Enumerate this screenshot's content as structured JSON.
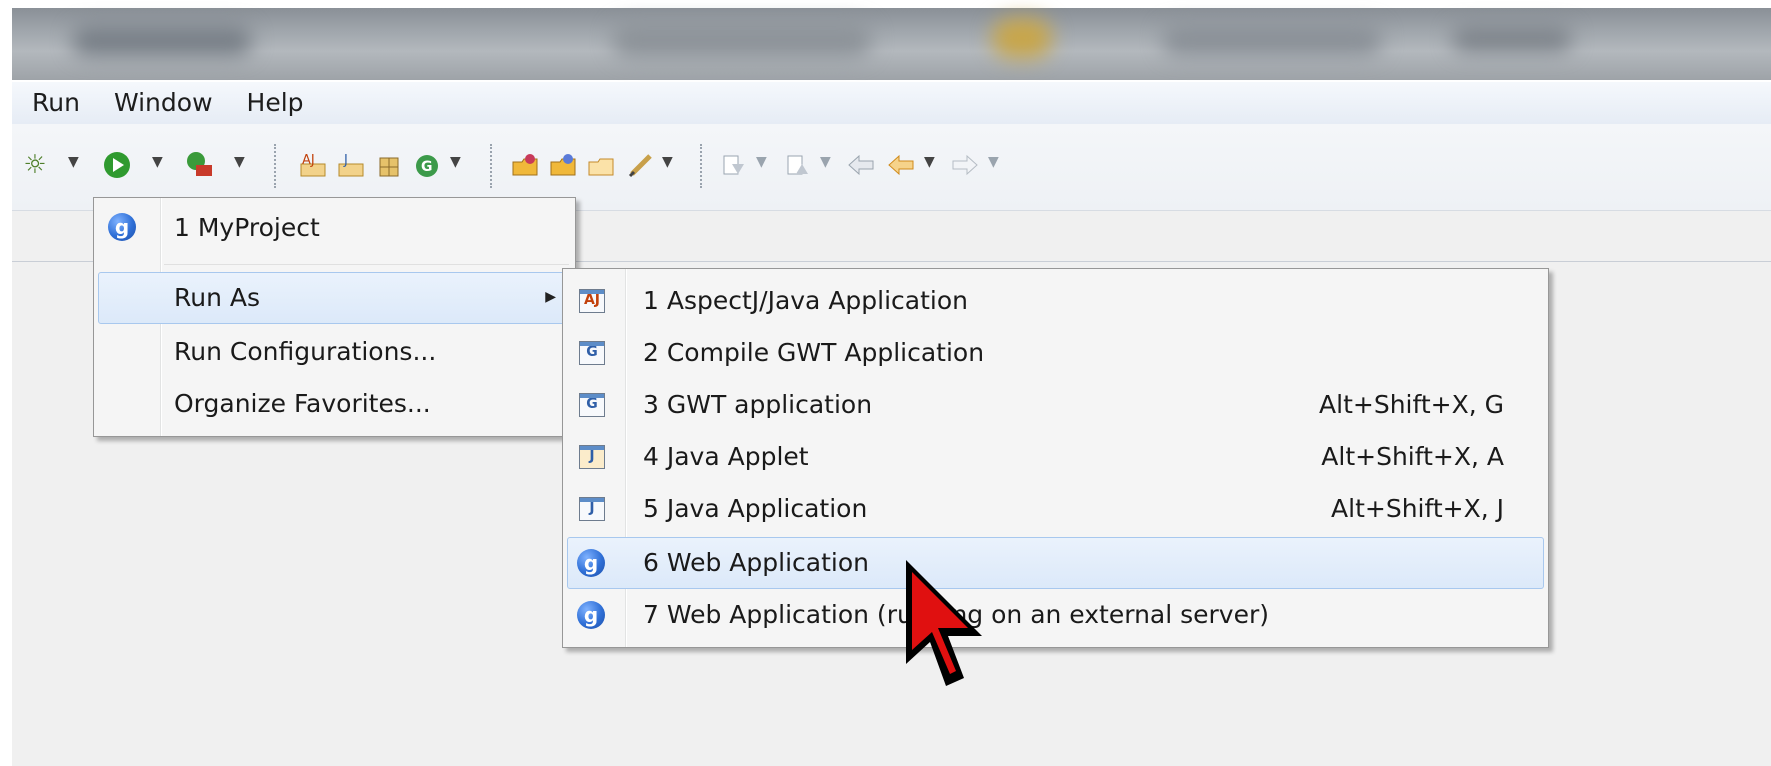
{
  "menubar": {
    "items": [
      {
        "label": "Run"
      },
      {
        "label": "Window"
      },
      {
        "label": "Help"
      }
    ]
  },
  "toolbar": {
    "icons": [
      {
        "name": "debug-icon",
        "glyph": "☼",
        "color": "#4f7f2a"
      },
      {
        "name": "run-icon",
        "glyph": "▶",
        "color": "#2f9a2f"
      },
      {
        "name": "run-external-tools-icon",
        "glyph": "◼",
        "color": "#c83a2a"
      },
      {
        "name": "new-aspectj-icon",
        "glyph": "✎",
        "color": "#c9a51f"
      },
      {
        "name": "new-java-class-icon",
        "glyph": "✎",
        "color": "#4a7bc9"
      },
      {
        "name": "new-package-icon",
        "glyph": "✚",
        "color": "#b08a2c"
      },
      {
        "name": "gwt-compile-icon",
        "glyph": "G",
        "color": "#2a8a3a"
      },
      {
        "name": "open-type-icon",
        "glyph": "▰",
        "color": "#d58a1a"
      },
      {
        "name": "open-resource-icon",
        "glyph": "▰",
        "color": "#6a8fcf"
      },
      {
        "name": "open-folder-icon",
        "glyph": "▱",
        "color": "#d58a1a"
      },
      {
        "name": "pen-icon",
        "glyph": "✐",
        "color": "#9a8a6a"
      },
      {
        "name": "next-annotation-icon",
        "glyph": "⇩",
        "color": "#8a96a4"
      },
      {
        "name": "prev-annotation-icon",
        "glyph": "⇧",
        "color": "#8a96a4"
      },
      {
        "name": "last-edit-icon",
        "glyph": "⇦",
        "color": "#9aa4ae"
      },
      {
        "name": "back-icon",
        "glyph": "⇦",
        "color": "#e3a12a"
      },
      {
        "name": "forward-icon",
        "glyph": "⇨",
        "color": "#b5bcc4"
      }
    ]
  },
  "run_menu": {
    "items": [
      {
        "label": "1 MyProject",
        "icon": "gwt-icon"
      },
      {
        "label": "Run As",
        "submenu_arrow": "▶"
      },
      {
        "label": "Run Configurations..."
      },
      {
        "label": "Organize Favorites..."
      }
    ]
  },
  "run_as_submenu": {
    "items": [
      {
        "label": "1 AspectJ/Java Application",
        "icon_text": "AJ",
        "icon_color": "#c2410c",
        "accel": ""
      },
      {
        "label": "2 Compile GWT Application",
        "icon_text": "G",
        "icon_color": "#2f5fa8",
        "accel": ""
      },
      {
        "label": "3 GWT application",
        "icon_text": "G",
        "icon_color": "#2f5fa8",
        "accel": "Alt+Shift+X, G"
      },
      {
        "label": "4 Java Applet",
        "icon_text": "J",
        "icon_color": "#2f5fa8",
        "accel": "Alt+Shift+X, A"
      },
      {
        "label": "5 Java Application",
        "icon_text": "J",
        "icon_color": "#2f5fa8",
        "accel": "Alt+Shift+X, J"
      },
      {
        "label": "6 Web Application",
        "icon_text": "g",
        "accel": ""
      },
      {
        "label": "7 Web Application (running on an external server)",
        "icon_text": "g",
        "accel": ""
      }
    ]
  },
  "colors": {
    "menu_bg": "#f5f5f5",
    "highlight": "#dce9f9",
    "cursor": "#e01010"
  }
}
